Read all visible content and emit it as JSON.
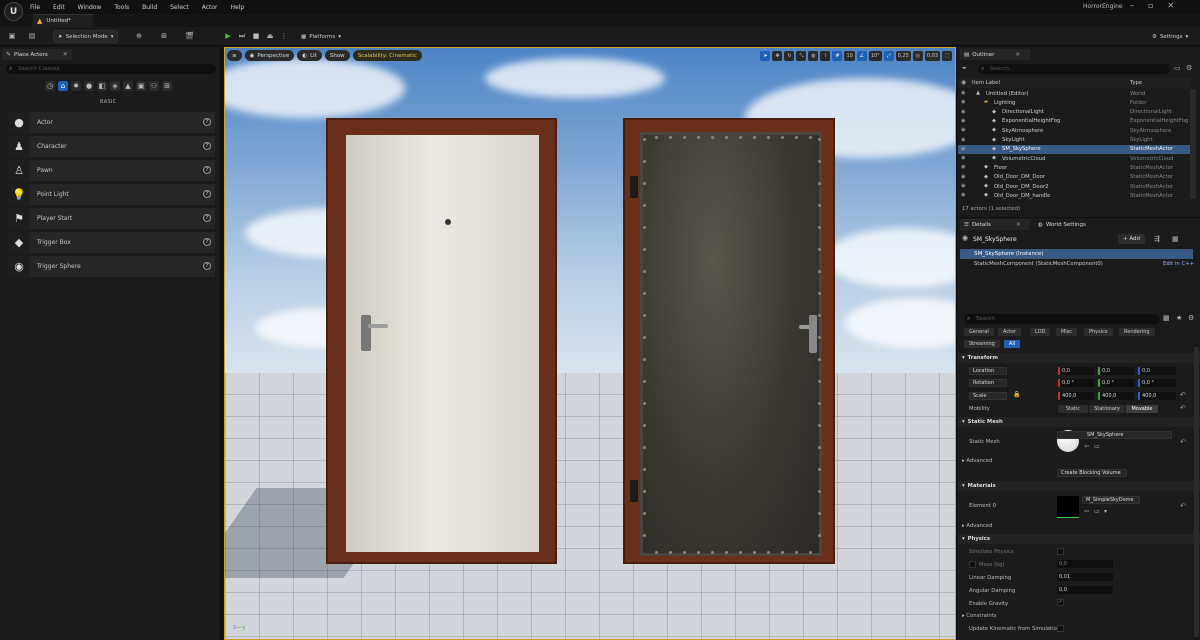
{
  "app": {
    "name": "HorrorEngine",
    "project_tab": "Untitled*",
    "menu": [
      "File",
      "Edit",
      "Window",
      "Tools",
      "Build",
      "Select",
      "Actor",
      "Help"
    ]
  },
  "toolbar": {
    "selection_mode": "Selection Mode",
    "platforms": "Platforms",
    "settings": "Settings"
  },
  "place_actors": {
    "tab_label": "Place Actors",
    "search_placeholder": "Search Classes",
    "section": "BASIC",
    "items": [
      "Actor",
      "Character",
      "Pawn",
      "Point Light",
      "Player Start",
      "Trigger Box",
      "Trigger Sphere"
    ]
  },
  "viewport": {
    "perspective": "Perspective",
    "lit": "Lit",
    "show": "Show",
    "scalability": "Scalability: Cinematic",
    "grid_snap": "10",
    "rot_snap": "10°",
    "scale_snap": "0,25",
    "camera_speed": "0,03"
  },
  "outliner": {
    "tab_label": "Outliner",
    "search_placeholder": "Search...",
    "col_label": "Item Label",
    "col_type": "Type",
    "rows": [
      {
        "label": "Untitled (Editor)",
        "type": "World",
        "indent": 0,
        "selected": false
      },
      {
        "label": "Lighting",
        "type": "Folder",
        "indent": 1,
        "selected": false
      },
      {
        "label": "DirectionalLight",
        "type": "DirectionalLight",
        "indent": 2,
        "selected": false
      },
      {
        "label": "ExponentialHeightFog",
        "type": "ExponentialHeightFog",
        "indent": 2,
        "selected": false
      },
      {
        "label": "SkyAtmosphere",
        "type": "SkyAtmosphere",
        "indent": 2,
        "selected": false
      },
      {
        "label": "SkyLight",
        "type": "SkyLight",
        "indent": 2,
        "selected": false
      },
      {
        "label": "SM_SkySphere",
        "type": "StaticMeshActor",
        "indent": 2,
        "selected": true
      },
      {
        "label": "VolumetricCloud",
        "type": "VolumetricCloud",
        "indent": 2,
        "selected": false
      },
      {
        "label": "Floor",
        "type": "StaticMeshActor",
        "indent": 1,
        "selected": false
      },
      {
        "label": "Old_Door_DM_Door",
        "type": "StaticMeshActor",
        "indent": 1,
        "selected": false
      },
      {
        "label": "Old_Door_DM_Door2",
        "type": "StaticMeshActor",
        "indent": 1,
        "selected": false
      },
      {
        "label": "Old_Door_DM_handle",
        "type": "StaticMeshActor",
        "indent": 1,
        "selected": false
      }
    ],
    "status": "17 actors (1 selected)"
  },
  "details": {
    "tab_label": "Details",
    "world_settings_tab": "World Settings",
    "actor_name": "SM_SkySphere",
    "add_label": "+ Add",
    "instance_label": "SM_SkySphere (Instance)",
    "component_label": "StaticMeshComponent (StaticMeshComponent0)",
    "edit_cpp": "Edit in C++",
    "search_placeholder": "Search",
    "filters": [
      "General",
      "Actor",
      "LOD",
      "Misc",
      "Physics",
      "Rendering",
      "Streaming",
      "All"
    ],
    "transform": {
      "section": "Transform",
      "location_label": "Location",
      "rotation_label": "Rotation",
      "scale_label": "Scale",
      "location": [
        "0,0",
        "0,0",
        "0,0"
      ],
      "rotation": [
        "0,0 °",
        "0,0 °",
        "0,0 °"
      ],
      "scale": [
        "400,0",
        "400,0",
        "400,0"
      ],
      "mobility_label": "Mobility",
      "mobility_options": [
        "Static",
        "Stationary",
        "Movable"
      ]
    },
    "static_mesh": {
      "section": "Static Mesh",
      "label": "Static Mesh",
      "value": "SM_SkySphere",
      "advanced": "Advanced",
      "create_blocking": "Create Blocking Volume"
    },
    "materials": {
      "section": "Materials",
      "element_label": "Element 0",
      "value": "M_SimpleSkyDome",
      "advanced": "Advanced"
    },
    "physics": {
      "section": "Physics",
      "simulate_physics": "Simulate Physics",
      "mass_kg": "Mass (kg)",
      "mass_value": "0,0",
      "linear_damping": "Linear Damping",
      "linear_value": "0,01",
      "angular_damping": "Angular Damping",
      "angular_value": "0,0",
      "enable_gravity": "Enable Gravity",
      "constraints": "Constraints",
      "update_kinematic": "Update Kinematic from Simulation"
    }
  }
}
